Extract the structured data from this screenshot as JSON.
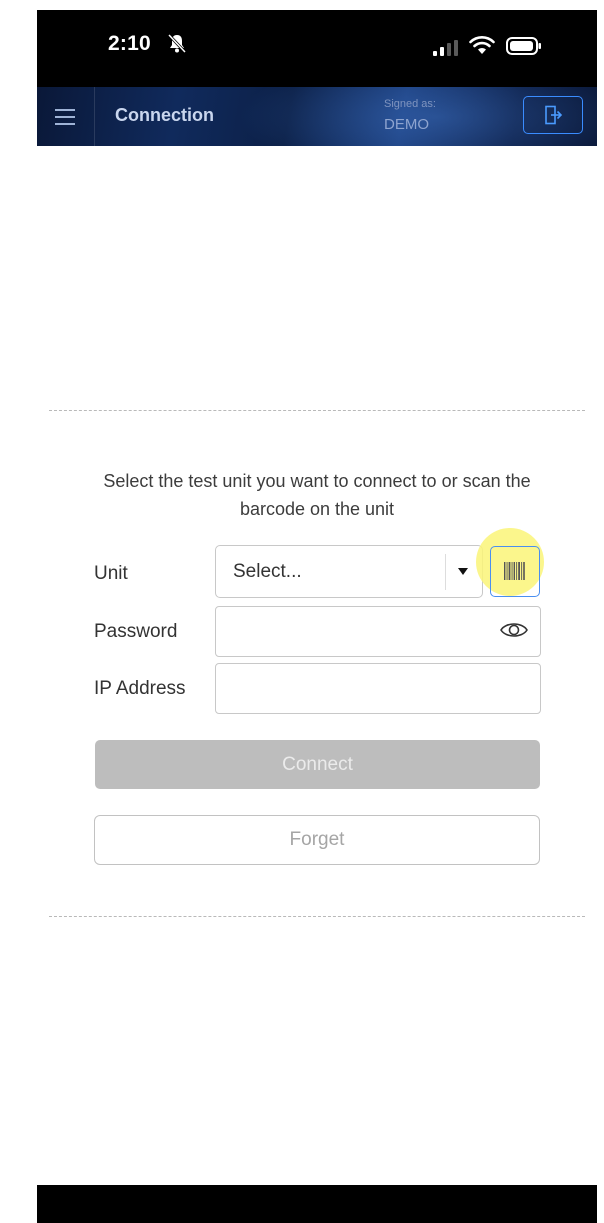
{
  "status_bar": {
    "time": "2:10"
  },
  "header": {
    "title": "Connection",
    "signed_as_label": "Signed as:",
    "signed_as_user": "DEMO"
  },
  "form": {
    "instruction": "Select the test unit you want to connect to or scan the barcode on the unit",
    "unit_label": "Unit",
    "unit_selected": "Select...",
    "password_label": "Password",
    "password_value": "",
    "ip_label": "IP Address",
    "ip_value": "",
    "connect_label": "Connect",
    "forget_label": "Forget"
  },
  "colors": {
    "accent": "#3a8cff",
    "header_bg": "#0c2047",
    "disabled_button": "#bdbdbd",
    "highlight": "#faf578"
  },
  "icons": {
    "menu": "hamburger-icon",
    "logout": "logout-icon",
    "scan": "barcode-icon",
    "password_toggle": "eye-icon",
    "dropdown": "chevron-down-icon"
  }
}
